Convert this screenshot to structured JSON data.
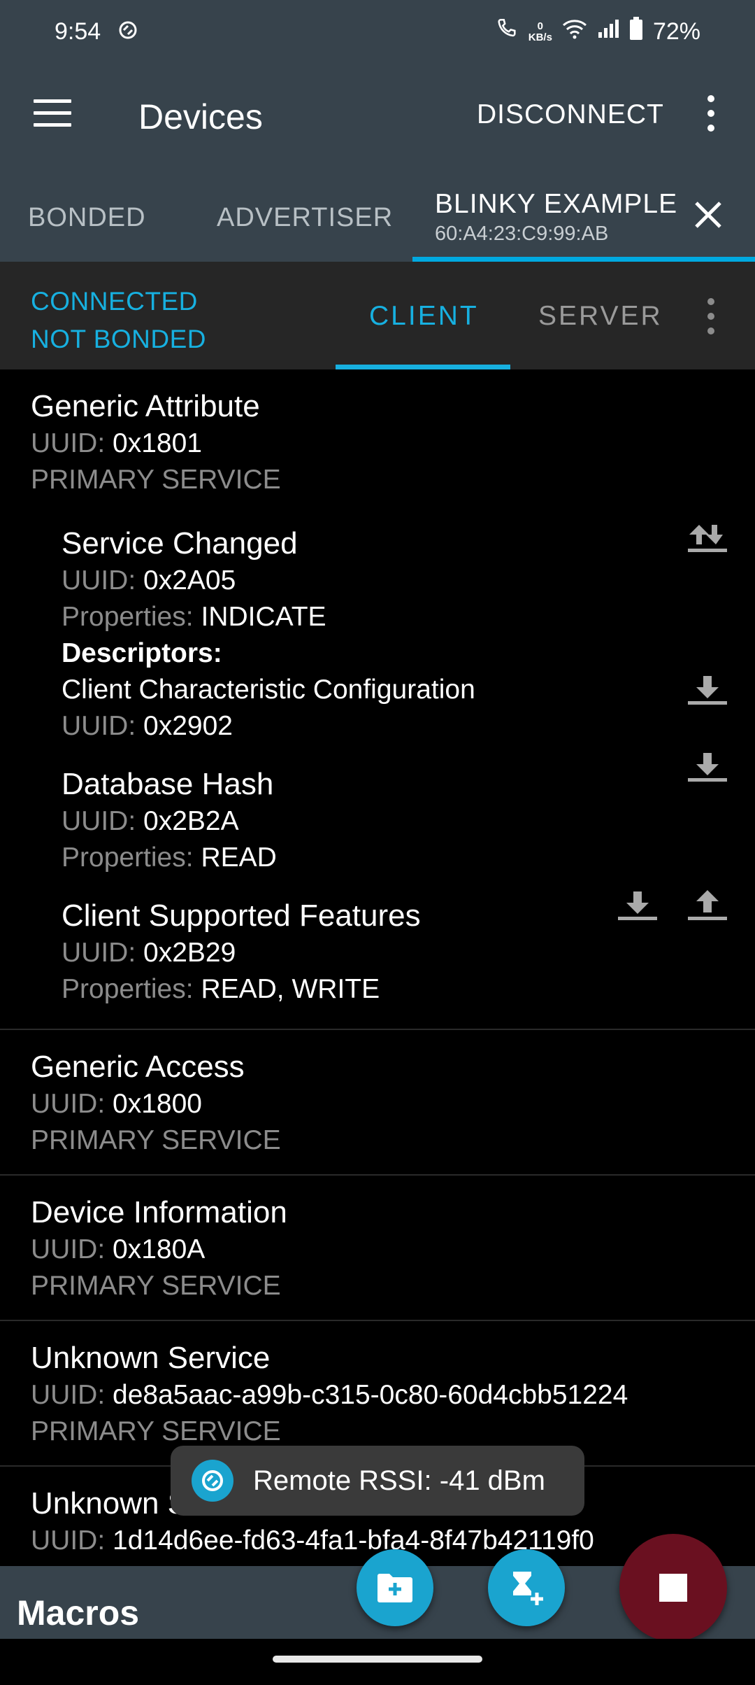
{
  "status_bar": {
    "time": "9:54",
    "net_speed": "0",
    "net_unit": "KB/s",
    "battery": "72%"
  },
  "app_bar": {
    "title": "Devices",
    "disconnect_label": "DISCONNECT"
  },
  "device_tabs": {
    "bonded_label": "BONDED",
    "advertiser_label": "ADVERTISER",
    "active_name": "BLINKY EXAMPLE",
    "active_address": "60:A4:23:C9:99:AB"
  },
  "connection": {
    "state": "CONNECTED",
    "bond_state": "NOT BONDED",
    "client_label": "CLIENT",
    "server_label": "SERVER"
  },
  "labels": {
    "uuid": "UUID:",
    "properties": "Properties:",
    "descriptors": "Descriptors:"
  },
  "services": [
    {
      "name": "Generic Attribute",
      "uuid": "0x1801",
      "type": "PRIMARY SERVICE",
      "characteristics": [
        {
          "name": "Service Changed",
          "uuid": "0x2A05",
          "properties": "INDICATE",
          "descriptor": {
            "name": "Client Characteristic Configuration",
            "uuid": "0x2902"
          }
        },
        {
          "name": "Database Hash",
          "uuid": "0x2B2A",
          "properties": "READ"
        },
        {
          "name": "Client Supported Features",
          "uuid": "0x2B29",
          "properties": "READ, WRITE"
        }
      ]
    },
    {
      "name": "Generic Access",
      "uuid": "0x1800",
      "type": "PRIMARY SERVICE"
    },
    {
      "name": "Device Information",
      "uuid": "0x180A",
      "type": "PRIMARY SERVICE"
    },
    {
      "name": "Unknown Service",
      "uuid": "de8a5aac-a99b-c315-0c80-60d4cbb51224",
      "type": "PRIMARY SERVICE"
    },
    {
      "name": "Unknown Service",
      "uuid": "1d14d6ee-fd63-4fa1-bfa4-8f47b42119f0"
    }
  ],
  "toast": {
    "text": "Remote RSSI: -41 dBm"
  },
  "macros": {
    "title": "Macros"
  },
  "icons": {
    "menu": "menu-icon",
    "overflow": "more-vert-icon",
    "close": "close-icon",
    "download": "download-icon",
    "upload": "upload-icon",
    "download_upload": "download-upload-icon",
    "add_folder": "create-new-folder-icon",
    "add_macro": "add-macro-icon",
    "stop": "stop-icon"
  },
  "colors": {
    "accent": "#17b0e0",
    "appbar": "#37434c",
    "fab": "#1aa4cf",
    "stop": "#6a1020"
  }
}
